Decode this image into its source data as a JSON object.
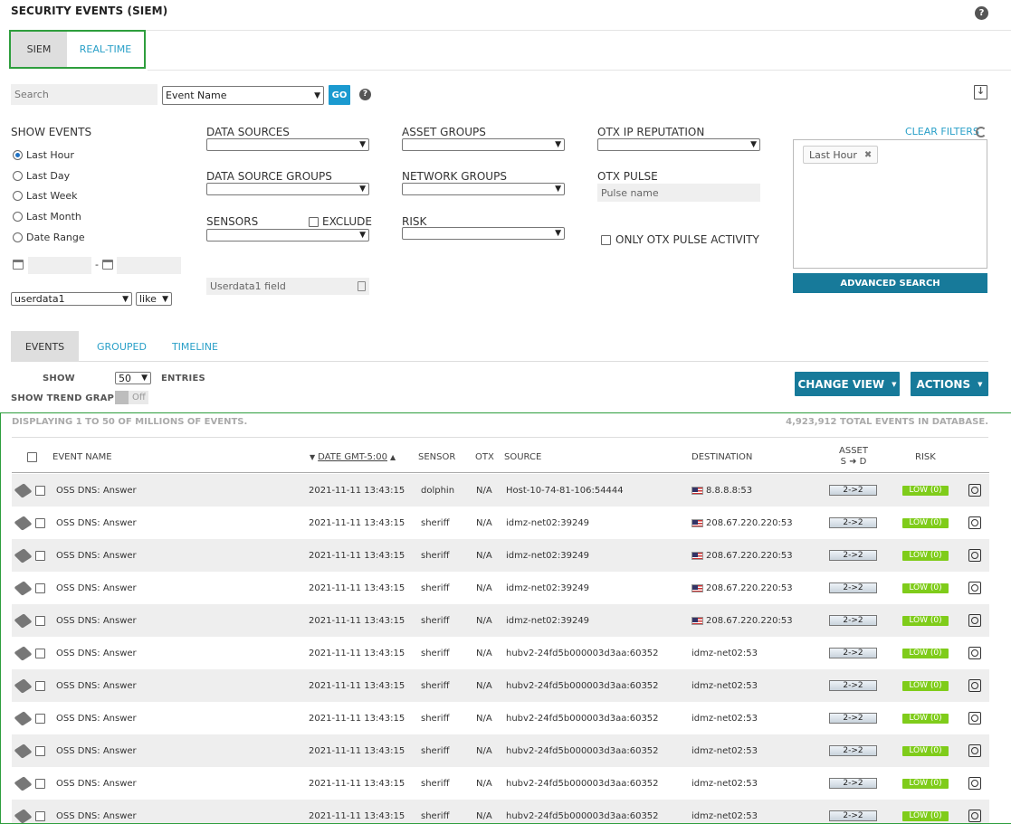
{
  "header": {
    "title": "SECURITY EVENTS (SIEM)"
  },
  "main_tabs": [
    {
      "label": "SIEM",
      "active": true
    },
    {
      "label": "REAL-TIME",
      "active": false
    }
  ],
  "search": {
    "placeholder": "Search",
    "field_select": "Event Name",
    "go_label": "GO"
  },
  "show_events": {
    "label": "SHOW EVENTS",
    "options": [
      {
        "label": "Last Hour",
        "selected": true
      },
      {
        "label": "Last Day",
        "selected": false
      },
      {
        "label": "Last Week",
        "selected": false
      },
      {
        "label": "Last Month",
        "selected": false
      },
      {
        "label": "Date Range",
        "selected": false
      }
    ],
    "date_separator": "-",
    "userdata_select": "userdata1",
    "operator_select": "like"
  },
  "filters": {
    "data_sources": "DATA SOURCES",
    "data_source_groups": "DATA SOURCE GROUPS",
    "sensors": "SENSORS",
    "exclude": "EXCLUDE",
    "userdata_field_placeholder": "Userdata1 field",
    "asset_groups": "ASSET GROUPS",
    "network_groups": "NETWORK GROUPS",
    "risk": "RISK",
    "otx_ip_reputation": "OTX IP REPUTATION",
    "otx_pulse": "OTX PULSE",
    "pulse_placeholder": "Pulse name",
    "only_otx": "ONLY OTX PULSE ACTIVITY",
    "clear_filters": "CLEAR FILTERS",
    "active_chip": "Last Hour",
    "advanced_search": "ADVANCED SEARCH"
  },
  "sub_tabs": [
    {
      "label": "EVENTS",
      "active": true
    },
    {
      "label": "GROUPED",
      "active": false
    },
    {
      "label": "TIMELINE",
      "active": false
    }
  ],
  "controls": {
    "show": "SHOW",
    "entries_value": "50",
    "entries": "ENTRIES",
    "trend_label": "SHOW TREND GRAPH",
    "trend_state": "Off",
    "change_view": "CHANGE VIEW",
    "actions": "ACTIONS"
  },
  "table": {
    "displaying": "DISPLAYING 1 TO 50 OF MILLIONS OF EVENTS.",
    "total": "4,923,912 TOTAL EVENTS IN DATABASE.",
    "columns": {
      "event_name": "EVENT NAME",
      "date": "DATE GMT-5:00",
      "sensor": "SENSOR",
      "otx": "OTX",
      "source": "SOURCE",
      "destination": "DESTINATION",
      "asset_top": "ASSET",
      "asset_sd": "S ➜ D",
      "risk": "RISK"
    },
    "rows": [
      {
        "event": "OSS DNS: Answer",
        "date": "2021-11-11 13:43:15",
        "sensor": "dolphin",
        "otx": "N/A",
        "source": "Host-10-74-81-106:54444",
        "destination": "8.8.8.8:53",
        "flag": true,
        "asset": "2->2",
        "risk": "LOW (0)"
      },
      {
        "event": "OSS DNS: Answer",
        "date": "2021-11-11 13:43:15",
        "sensor": "sheriff",
        "otx": "N/A",
        "source": "idmz-net02:39249",
        "destination": "208.67.220.220:53",
        "flag": true,
        "asset": "2->2",
        "risk": "LOW (0)"
      },
      {
        "event": "OSS DNS: Answer",
        "date": "2021-11-11 13:43:15",
        "sensor": "sheriff",
        "otx": "N/A",
        "source": "idmz-net02:39249",
        "destination": "208.67.220.220:53",
        "flag": true,
        "asset": "2->2",
        "risk": "LOW (0)"
      },
      {
        "event": "OSS DNS: Answer",
        "date": "2021-11-11 13:43:15",
        "sensor": "sheriff",
        "otx": "N/A",
        "source": "idmz-net02:39249",
        "destination": "208.67.220.220:53",
        "flag": true,
        "asset": "2->2",
        "risk": "LOW (0)"
      },
      {
        "event": "OSS DNS: Answer",
        "date": "2021-11-11 13:43:15",
        "sensor": "sheriff",
        "otx": "N/A",
        "source": "idmz-net02:39249",
        "destination": "208.67.220.220:53",
        "flag": true,
        "asset": "2->2",
        "risk": "LOW (0)"
      },
      {
        "event": "OSS DNS: Answer",
        "date": "2021-11-11 13:43:15",
        "sensor": "sheriff",
        "otx": "N/A",
        "source": "hubv2-24fd5b000003d3aa:60352",
        "destination": "idmz-net02:53",
        "flag": false,
        "asset": "2->2",
        "risk": "LOW (0)"
      },
      {
        "event": "OSS DNS: Answer",
        "date": "2021-11-11 13:43:15",
        "sensor": "sheriff",
        "otx": "N/A",
        "source": "hubv2-24fd5b000003d3aa:60352",
        "destination": "idmz-net02:53",
        "flag": false,
        "asset": "2->2",
        "risk": "LOW (0)"
      },
      {
        "event": "OSS DNS: Answer",
        "date": "2021-11-11 13:43:15",
        "sensor": "sheriff",
        "otx": "N/A",
        "source": "hubv2-24fd5b000003d3aa:60352",
        "destination": "idmz-net02:53",
        "flag": false,
        "asset": "2->2",
        "risk": "LOW (0)"
      },
      {
        "event": "OSS DNS: Answer",
        "date": "2021-11-11 13:43:15",
        "sensor": "sheriff",
        "otx": "N/A",
        "source": "hubv2-24fd5b000003d3aa:60352",
        "destination": "idmz-net02:53",
        "flag": false,
        "asset": "2->2",
        "risk": "LOW (0)"
      },
      {
        "event": "OSS DNS: Answer",
        "date": "2021-11-11 13:43:15",
        "sensor": "sheriff",
        "otx": "N/A",
        "source": "hubv2-24fd5b000003d3aa:60352",
        "destination": "idmz-net02:53",
        "flag": false,
        "asset": "2->2",
        "risk": "LOW (0)"
      },
      {
        "event": "OSS DNS: Answer",
        "date": "2021-11-11 13:43:15",
        "sensor": "sheriff",
        "otx": "N/A",
        "source": "hubv2-24fd5b000003d3aa:60352",
        "destination": "idmz-net02:53",
        "flag": false,
        "asset": "2->2",
        "risk": "LOW (0)"
      }
    ]
  },
  "colors": {
    "accent": "#2aa0c8",
    "button": "#177a9a",
    "go": "#1b9ad0",
    "risk_low": "#7fcc1a",
    "highlight": "#2e9e3d"
  }
}
